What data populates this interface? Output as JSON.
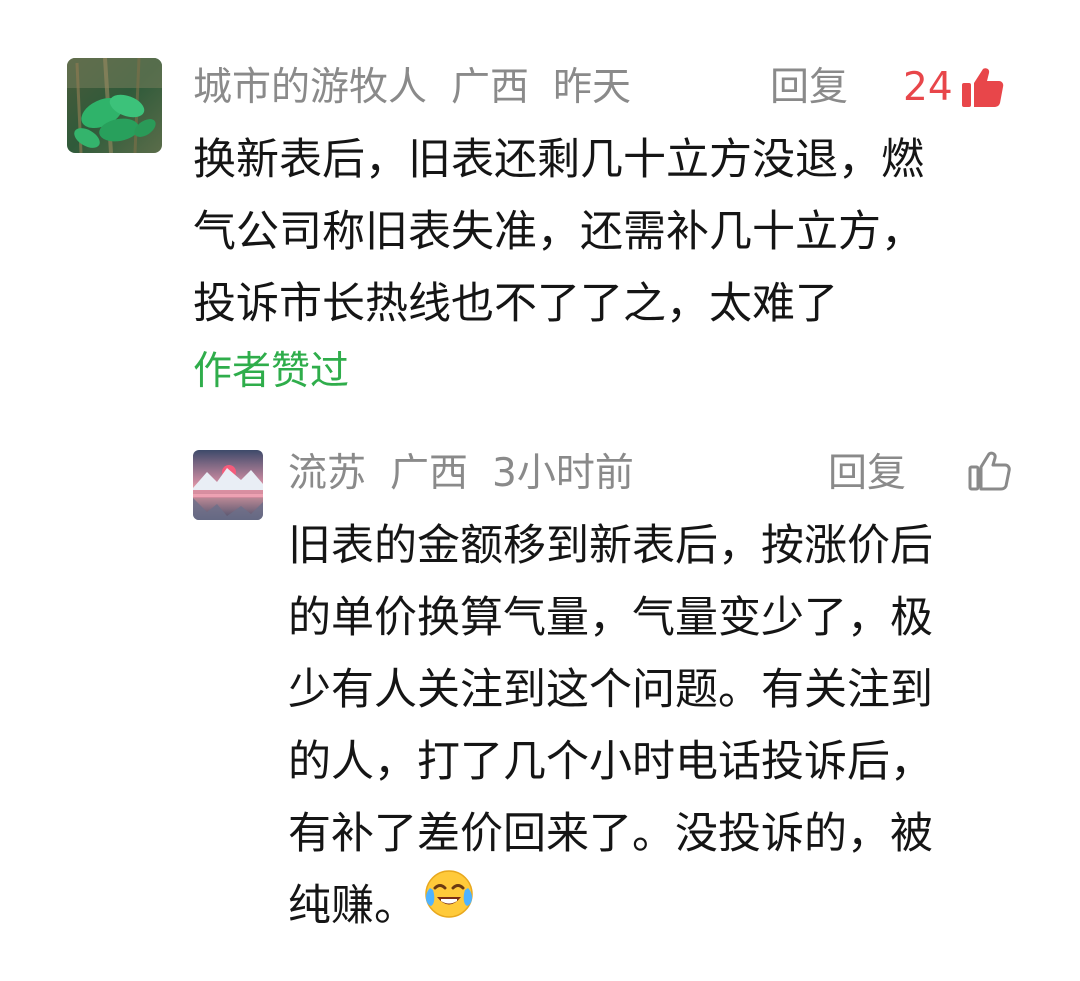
{
  "comment": {
    "username": "城市的游牧人",
    "location": "广西",
    "time": "昨天",
    "reply_label": "回复",
    "like_count": "24",
    "lines": [
      "换新表后，旧表还剩几十立方没退，燃",
      "气公司称旧表失准，还需补几十立方，",
      "投诉市长热线也不了了之，太难了"
    ],
    "author_liked": "作者赞过",
    "avatar_icon": "avatar-plant-icon",
    "like_icon": "thumbs-up-filled-icon"
  },
  "reply": {
    "username": "流苏",
    "location": "广西",
    "time": "3小时前",
    "reply_label": "回复",
    "avatar_icon": "avatar-mountain-lake-icon",
    "like_icon": "thumbs-up-outline-icon",
    "emoji_icon": "crying-laughing-emoji-icon",
    "lines": [
      "旧表的金额移到新表后，按涨价后",
      "的单价换算气量，气量变少了，极",
      "少有人关注到这个问题。有关注到",
      "的人，打了几个小时电话投诉后，",
      "有补了差价回来了。没投诉的，被",
      "纯赚。"
    ]
  },
  "colors": {
    "meta_gray": "#8a8a8a",
    "like_red": "#e8464a",
    "author_liked_green": "#2fad4b",
    "body_text": "#151515"
  }
}
